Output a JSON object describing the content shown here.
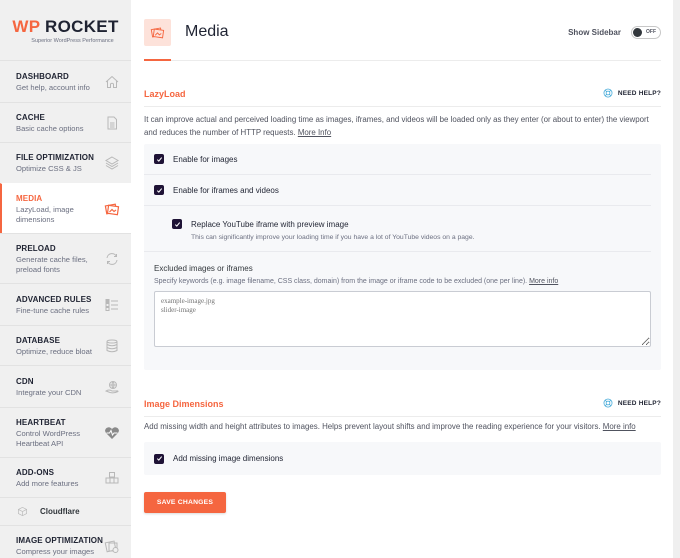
{
  "brand": {
    "logo_wp": "WP",
    "logo_rest": " ROCKET",
    "tagline": "Superior WordPress Performance",
    "accent_color": "#f56640",
    "checkbox_color": "#1f1336"
  },
  "sidebar": {
    "items": [
      {
        "title": "DASHBOARD",
        "desc": "Get help, account info",
        "icon": "home-icon",
        "active": false
      },
      {
        "title": "CACHE",
        "desc": "Basic cache options",
        "icon": "file-icon",
        "active": false
      },
      {
        "title": "FILE OPTIMIZATION",
        "desc": "Optimize CSS & JS",
        "icon": "layers-icon",
        "active": false
      },
      {
        "title": "MEDIA",
        "desc": "LazyLoad, image dimensions",
        "icon": "images-icon",
        "active": true
      },
      {
        "title": "PRELOAD",
        "desc": "Generate cache files, preload fonts",
        "icon": "refresh-icon",
        "active": false
      },
      {
        "title": "ADVANCED RULES",
        "desc": "Fine-tune cache rules",
        "icon": "checklist-icon",
        "active": false
      },
      {
        "title": "DATABASE",
        "desc": "Optimize, reduce bloat",
        "icon": "database-icon",
        "active": false
      },
      {
        "title": "CDN",
        "desc": "Integrate your CDN",
        "icon": "globe-hand-icon",
        "active": false
      },
      {
        "title": "HEARTBEAT",
        "desc": "Control WordPress Heartbeat API",
        "icon": "heartbeat-icon",
        "active": false
      },
      {
        "title": "ADD-ONS",
        "desc": "Add more features",
        "icon": "boxes-icon",
        "active": false
      }
    ],
    "cloudflare": {
      "label": "Cloudflare",
      "icon": "cube-icon"
    },
    "image_optimization": {
      "title": "IMAGE OPTIMIZATION",
      "desc": "Compress your images",
      "icon": "image-compress-icon"
    }
  },
  "header": {
    "title": "Media",
    "show_sidebar_label": "Show Sidebar",
    "toggle_state": "OFF"
  },
  "lazyload": {
    "title": "LazyLoad",
    "need_help": "NEED HELP?",
    "description": "It can improve actual and perceived loading time as images, iframes, and videos will be loaded only as they enter (or about to enter) the viewport and reduces the number of HTTP requests. ",
    "more_info": "More Info",
    "options": [
      {
        "label": "Enable for images",
        "checked": true
      },
      {
        "label": "Enable for iframes and videos",
        "checked": true
      }
    ],
    "youtube": {
      "label": "Replace YouTube iframe with preview image",
      "desc": "This can significantly improve your loading time if you have a lot of YouTube videos on a page.",
      "checked": true
    },
    "excluded": {
      "title": "Excluded images or iframes",
      "desc": "Specify keywords (e.g. image filename, CSS class, domain) from the image or iframe code to be excluded (one per line). ",
      "more_info": "More info",
      "placeholder": "example-image.jpg\nslider-image",
      "value": ""
    }
  },
  "image_dimensions": {
    "title": "Image Dimensions",
    "need_help": "NEED HELP?",
    "description": "Add missing width and height attributes to images. Helps prevent layout shifts and improve the reading experience for your visitors. ",
    "more_info": "More info",
    "option": {
      "label": "Add missing image dimensions",
      "checked": true
    }
  },
  "save_button": "SAVE CHANGES"
}
